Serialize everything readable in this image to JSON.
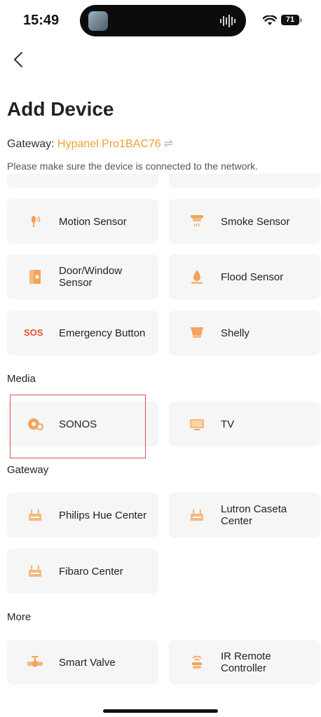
{
  "status_bar": {
    "time": "15:49",
    "battery": "71"
  },
  "header": {
    "title": "Add Device",
    "gateway_label": "Gateway: ",
    "gateway_name": "Hypanel Pro1BAC76",
    "swap_symbol": "⇌",
    "hint": "Please make sure the device is connected to the network."
  },
  "sections": {
    "media": "Media",
    "gateway": "Gateway",
    "more": "More"
  },
  "devices": {
    "motion_sensor": "Motion Sensor",
    "smoke_sensor": "Smoke Sensor",
    "door_window_sensor": "Door/Window Sensor",
    "flood_sensor": "Flood Sensor",
    "emergency_button": "Emergency Button",
    "emergency_icon_text": "SOS",
    "shelly": "Shelly",
    "sonos": "SONOS",
    "tv": "TV",
    "philips_hue_center": "Philips Hue Center",
    "lutron_caseta_center": "Lutron Caseta Center",
    "fibaro_center": "Fibaro Center",
    "smart_valve": "Smart Valve",
    "ir_remote_controller": "IR Remote Controller"
  },
  "icons": {
    "back": "chevron-left-icon",
    "motion": "motion-sensor-icon",
    "smoke": "smoke-sensor-icon",
    "door": "door-window-sensor-icon",
    "flood": "flood-sensor-icon",
    "sos": "sos-icon",
    "shelly": "shelly-icon",
    "sonos": "speaker-icon",
    "tv": "tv-icon",
    "hub": "hub-icon",
    "valve": "valve-icon",
    "ir": "ir-remote-icon"
  },
  "colors": {
    "accent": "#f0a030",
    "icon": "#f3a35c",
    "card": "#f6f6f6",
    "highlight": "#e05050"
  }
}
